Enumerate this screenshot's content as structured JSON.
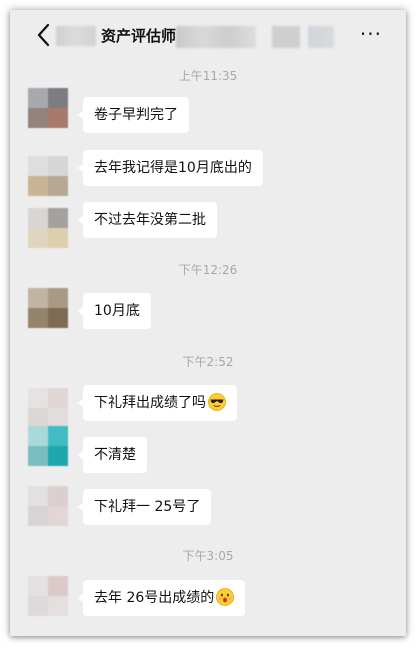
{
  "header": {
    "title": "资产评估师",
    "back_icon": "chevron-left-icon",
    "more_icon": "more-horizontal-icon",
    "more_text": "···"
  },
  "messages": [
    {
      "time": "上午11:35"
    },
    {
      "text": "卷子早判完了"
    },
    {
      "text": "去年我记得是10月底出的"
    },
    {
      "text": "不过去年没第二批"
    },
    {
      "time": "下午12:26"
    },
    {
      "text": "10月底"
    },
    {
      "time": "下午2:52"
    },
    {
      "text": "下礼拜出成绩了吗",
      "emoji": "sunglasses-emoji-icon"
    },
    {
      "text": "不清楚"
    },
    {
      "text": "下礼拜一  25号了"
    },
    {
      "time": "下午3:05"
    },
    {
      "text": "去年 26号出成绩的",
      "emoji": "surprised-face-emoji-icon"
    }
  ],
  "colors": {
    "background": "#ededed",
    "bubble": "#ffffff",
    "timestamp": "#a8a8a8"
  }
}
